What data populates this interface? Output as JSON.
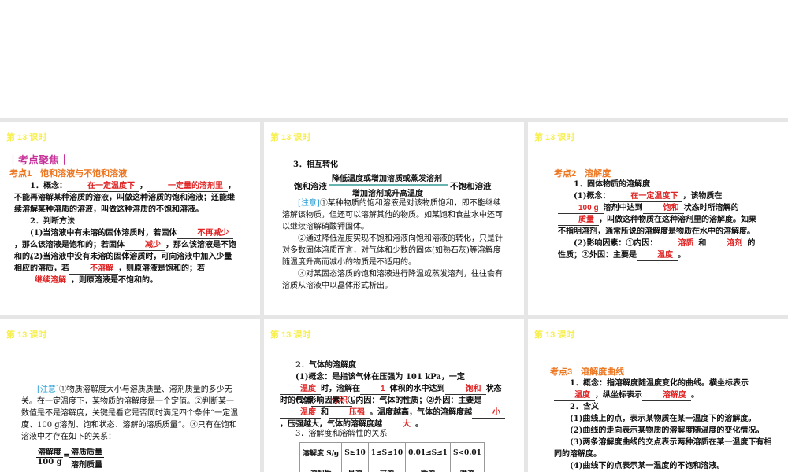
{
  "lesson_label": "第 13 课时",
  "slide1": {
    "focus": "｜考点聚焦｜",
    "heading": "考点1　饱和溶液与不饱和溶液",
    "p1": [
      {
        "t": "1．概念："
      },
      {
        "b": "在一定温度下"
      },
      {
        "t": "，"
      },
      {
        "b": "一定量的溶剂里"
      },
      {
        "t": "，不能再溶解某种溶质的溶液，叫做这种溶质的饱和溶液；还能继续溶解某种溶质的溶液，叫做这种溶质的不饱和溶液。"
      }
    ],
    "p2": [
      {
        "t": "2．判断方法"
      }
    ],
    "p3": [
      {
        "t": "(1)当溶液中有未溶的固体溶质时，若固体"
      },
      {
        "b": "不再减少"
      },
      {
        "t": "，那么该溶液是饱和的；若固体"
      },
      {
        "b": "减少"
      },
      {
        "t": "，那么该溶液是不饱和的。"
      }
    ],
    "p4": [
      {
        "t": "(2)当溶液中没有未溶的固体溶质时，可向溶液中加入少量相应的溶质，若"
      },
      {
        "b": "不溶解"
      },
      {
        "t": "，则原溶液是饱和的；若"
      },
      {
        "b": "继续溶解"
      },
      {
        "t": "，则原溶液是不饱和的。"
      }
    ]
  },
  "slide2": {
    "title": "3．相互转化",
    "left": "饱和溶液",
    "right": "不饱和溶液",
    "arrow_top": "降低温度或增加溶质或蒸发溶剂",
    "arrow_bottom": "增加溶剂或升高温度",
    "note": [
      {
        "n": "[注意]"
      },
      {
        "t": "①某种物质的饱和溶液是对该物质饱和，即不能继续溶解该物质，但还可以溶解其他的物质。如某饱和食盐水中还可以继续溶解硝酸钾固体。"
      }
    ],
    "note2": [
      {
        "t": "②通过降低温度实现不饱和溶液向饱和溶液的转化，只是针对多数固体溶质而言，对气体和少数的固体(如熟石灰)等溶解度随温度升高而减小的物质是不适用的。"
      }
    ],
    "note3": [
      {
        "t": "③对某固态溶质的饱和溶液进行降温或蒸发溶剂，往往会有溶质从溶液中以晶体形式析出。"
      }
    ]
  },
  "slide3": {
    "heading": "考点2　溶解度",
    "p1": [
      {
        "t": "1．固体物质的溶解度"
      }
    ],
    "p2": [
      {
        "t": "(1)概念："
      },
      {
        "b": "在一定温度下"
      },
      {
        "t": "，该物质在"
      },
      {
        "b": "100 g"
      },
      {
        "t": "溶剂中达到"
      },
      {
        "b": "饱和"
      },
      {
        "t": "状态时所溶解的"
      },
      {
        "b": "质量"
      },
      {
        "t": "，叫做这种物质在这种溶剂里的溶解度。如果不指明溶剂，通常所说的溶解度是物质在水中的溶解度。"
      }
    ],
    "p3": [
      {
        "t": "(2)影响因素：①内因："
      },
      {
        "b": "溶质"
      },
      {
        "t": "和"
      },
      {
        "b": "溶剂"
      },
      {
        "t": "的性质；②外因：主要是"
      },
      {
        "b": "温度"
      },
      {
        "t": "。"
      }
    ]
  },
  "slide4": {
    "note": [
      {
        "n": "[注意]"
      },
      {
        "t": "①物质溶解度大小与溶质质量、溶剂质量的多少无关。在一定温度下，某物质的溶解度是一个定值。②判断某一数值是不是溶解度，关键是看它是否同时满足四个条件“一定温度、100 g溶剂、饱和状态、溶解的溶质质量”。③只有在饱和溶液中才存在如下的关系："
      }
    ],
    "frac_left_num": "溶解度",
    "frac_left_den": "100 g",
    "equals": "=",
    "frac_right_num": "溶质质量",
    "frac_right_den": "溶剂质量"
  },
  "slide5": {
    "p1": [
      {
        "t": "2．气体的溶解度"
      }
    ],
    "p2": [
      {
        "t": "(1)概念：是指该气体在压强为 101 kPa，一定"
      },
      {
        "b": "温度"
      },
      {
        "t": "时，溶解在"
      },
      {
        "b": "1"
      },
      {
        "t": "体积的水中达到"
      },
      {
        "b": "饱和"
      },
      {
        "t": "状态时的气体"
      },
      {
        "b": "体积"
      },
      {
        "t": "。"
      }
    ],
    "p3": [
      {
        "t": "(2)影响因素：①内因：气体的性质；②外因：主要是"
      },
      {
        "b": "温度"
      },
      {
        "t": "和"
      },
      {
        "b": "压强"
      },
      {
        "t": "。温度越高，气体的溶解度越"
      },
      {
        "b": "小"
      },
      {
        "t": "，压强越大，气体的溶解度越"
      },
      {
        "b": "大"
      },
      {
        "t": "。"
      }
    ],
    "p4": [
      {
        "t": "3．溶解度和溶解性的关系"
      }
    ],
    "table": {
      "row1": [
        "溶解度 S/g",
        "S≥10",
        "1≤S≤10",
        "0.01≤S≤1",
        "S<0.01"
      ],
      "row2": [
        "溶解性",
        "易溶",
        "可溶",
        "微溶",
        "难溶"
      ]
    }
  },
  "slide6": {
    "heading": "考点3　溶解度曲线",
    "p1": [
      {
        "t": "1．概念：指溶解度随温度变化的曲线。横坐标表示"
      },
      {
        "b": "温度"
      },
      {
        "t": "，纵坐标表示"
      },
      {
        "b": "溶解度"
      },
      {
        "t": "。"
      }
    ],
    "p2": [
      {
        "t": "2．含义"
      }
    ],
    "p3": [
      {
        "t": "(1)曲线上的点，表示某物质在某一温度下的溶解度。"
      }
    ],
    "p4": [
      {
        "t": "(2)曲线的走向表示某物质的溶解度随温度的变化情况。"
      }
    ],
    "p5": [
      {
        "t": "(3)两条溶解度曲线的交点表示两种溶质在某一温度下有相同的溶解度。"
      }
    ],
    "p6": [
      {
        "t": "(4)曲线下的点表示某一温度的不饱和溶液。"
      }
    ]
  }
}
